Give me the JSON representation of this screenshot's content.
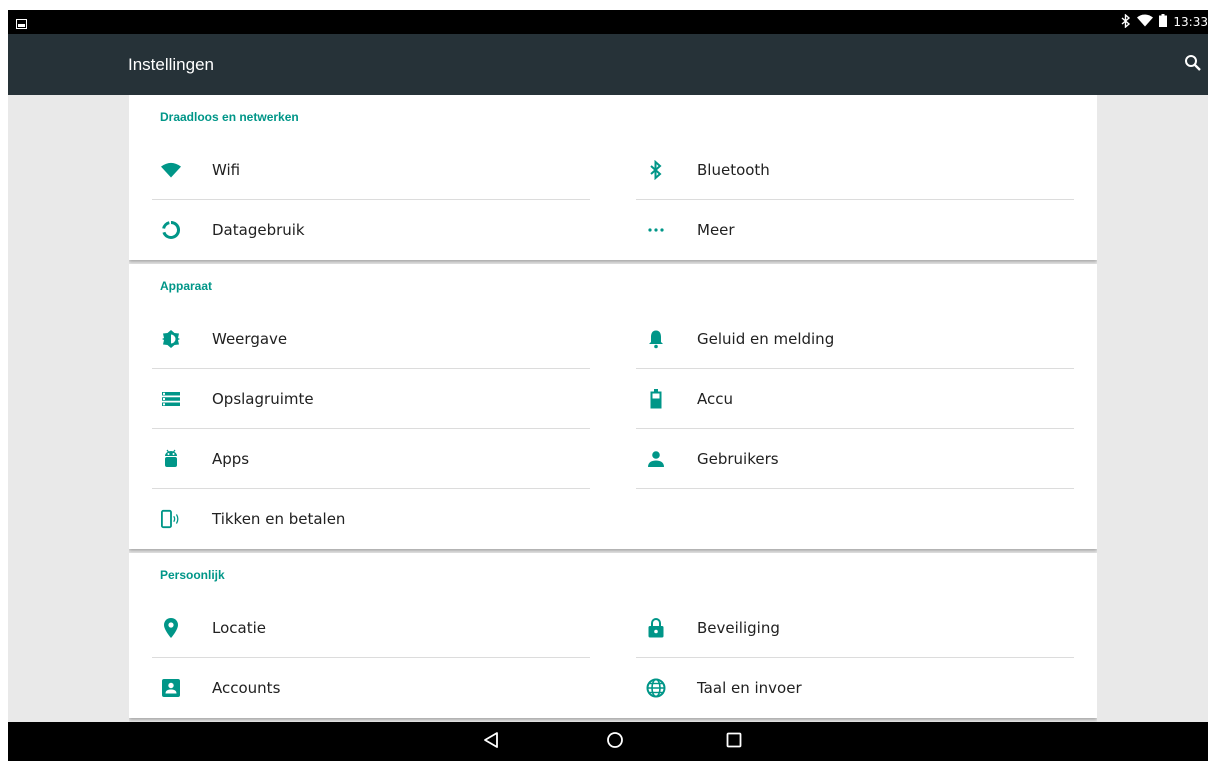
{
  "status_bar": {
    "time": "13:33",
    "icons": [
      "notification-image-icon",
      "bluetooth-icon",
      "wifi-icon",
      "battery-icon"
    ]
  },
  "app_bar": {
    "title": "Instellingen",
    "search_icon": "search-icon"
  },
  "accent_color": "#009688",
  "sections": {
    "wireless": {
      "header": "Draadloos en netwerken",
      "items": [
        {
          "label": "Wifi",
          "icon": "wifi-icon"
        },
        {
          "label": "Bluetooth",
          "icon": "bluetooth-icon"
        },
        {
          "label": "Datagebruik",
          "icon": "data-usage-icon"
        },
        {
          "label": "Meer",
          "icon": "more-icon"
        }
      ]
    },
    "device": {
      "header": "Apparaat",
      "items": [
        {
          "label": "Weergave",
          "icon": "display-icon"
        },
        {
          "label": "Geluid en melding",
          "icon": "bell-icon"
        },
        {
          "label": "Opslagruimte",
          "icon": "storage-icon"
        },
        {
          "label": "Accu",
          "icon": "battery-icon"
        },
        {
          "label": "Apps",
          "icon": "android-icon"
        },
        {
          "label": "Gebruikers",
          "icon": "person-icon"
        },
        {
          "label": "Tikken en betalen",
          "icon": "nfc-phone-icon"
        }
      ]
    },
    "personal": {
      "header": "Persoonlijk",
      "items": [
        {
          "label": "Locatie",
          "icon": "location-pin-icon"
        },
        {
          "label": "Beveiliging",
          "icon": "lock-icon"
        },
        {
          "label": "Accounts",
          "icon": "account-box-icon"
        },
        {
          "label": "Taal en invoer",
          "icon": "globe-icon"
        }
      ]
    }
  },
  "nav_bar": {
    "buttons": [
      "back-icon",
      "home-icon",
      "recents-icon"
    ]
  }
}
